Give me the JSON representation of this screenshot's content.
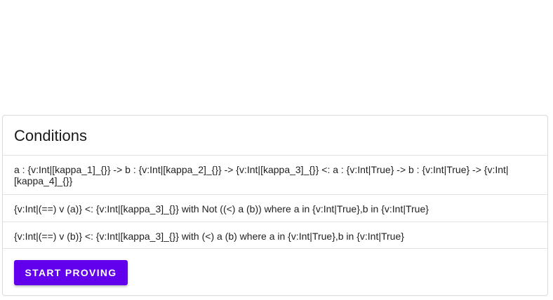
{
  "card": {
    "title": "Conditions",
    "conditions": [
      "a : {v:Int|[kappa_1]_{}} -> b : {v:Int|[kappa_2]_{}} -> {v:Int|[kappa_3]_{}} <: a : {v:Int|True} -> b : {v:Int|True} -> {v:Int|[kappa_4]_{}}",
      "{v:Int|(==) v (a)} <: {v:Int|[kappa_3]_{}} with Not ((<) a (b)) where a in {v:Int|True},b in {v:Int|True}",
      "{v:Int|(==) v (b)} <: {v:Int|[kappa_3]_{}} with (<) a (b) where a in {v:Int|True},b in {v:Int|True}"
    ],
    "start_button_label": "START PROVING"
  },
  "colors": {
    "primary": "#6200ee",
    "border": "#dcdcdc"
  }
}
